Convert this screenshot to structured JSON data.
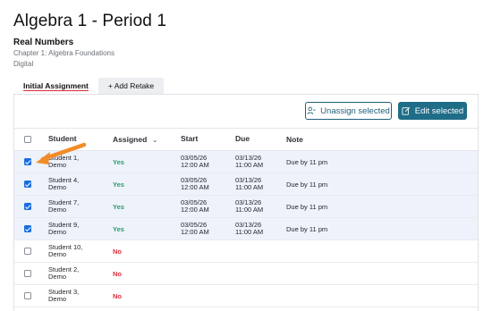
{
  "page": {
    "title": "Algebra 1 - Period 1",
    "subtitle": "Real Numbers",
    "chapter": "Chapter 1: Algebra Foundations",
    "mode": "Digital"
  },
  "tabs": [
    {
      "label": "Initial Assignment",
      "active": true
    },
    {
      "label": "+ Add Retake",
      "active": false
    }
  ],
  "toolbar": {
    "unassign_label": "Unassign selected",
    "edit_label": "Edit selected",
    "accent": "#1f6d87"
  },
  "table": {
    "headers": {
      "student": "Student",
      "assigned": "Assigned",
      "start": "Start",
      "due": "Due",
      "note": "Note"
    },
    "rows": [
      {
        "checked": true,
        "student_line1": "Student 1,",
        "student_line2": "Demo",
        "assigned": "Yes",
        "start_date": "03/05/26",
        "start_time": "12:00 AM",
        "due_date": "03/13/26",
        "due_time": "11:00 AM",
        "note": "Due by 11 pm"
      },
      {
        "checked": true,
        "student_line1": "Student 4,",
        "student_line2": "Demo",
        "assigned": "Yes",
        "start_date": "03/05/26",
        "start_time": "12:00 AM",
        "due_date": "03/13/26",
        "due_time": "11:00 AM",
        "note": "Due by 11 pm"
      },
      {
        "checked": true,
        "student_line1": "Student 7,",
        "student_line2": "Demo",
        "assigned": "Yes",
        "start_date": "03/05/26",
        "start_time": "12:00 AM",
        "due_date": "03/13/26",
        "due_time": "11:00 AM",
        "note": "Due by 11 pm"
      },
      {
        "checked": true,
        "student_line1": "Student 9,",
        "student_line2": "Demo",
        "assigned": "Yes",
        "start_date": "03/05/26",
        "start_time": "12:00 AM",
        "due_date": "03/13/26",
        "due_time": "11:00 AM",
        "note": "Due by 11 pm"
      },
      {
        "checked": false,
        "student_line1": "Student 10,",
        "student_line2": "Demo",
        "assigned": "No",
        "start_date": "",
        "start_time": "",
        "due_date": "",
        "due_time": "",
        "note": ""
      },
      {
        "checked": false,
        "student_line1": "Student 2,",
        "student_line2": "Demo",
        "assigned": "No",
        "start_date": "",
        "start_time": "",
        "due_date": "",
        "due_time": "",
        "note": ""
      },
      {
        "checked": false,
        "student_line1": "Student 3,",
        "student_line2": "Demo",
        "assigned": "No",
        "start_date": "",
        "start_time": "",
        "due_date": "",
        "due_time": "",
        "note": ""
      }
    ]
  },
  "colors": {
    "yes": "#2a9d6a",
    "no": "#d9303b",
    "selected_row": "#eef2fb",
    "checkbox_on": "#1a6ee0",
    "annotation_arrow": "#f28c28"
  }
}
